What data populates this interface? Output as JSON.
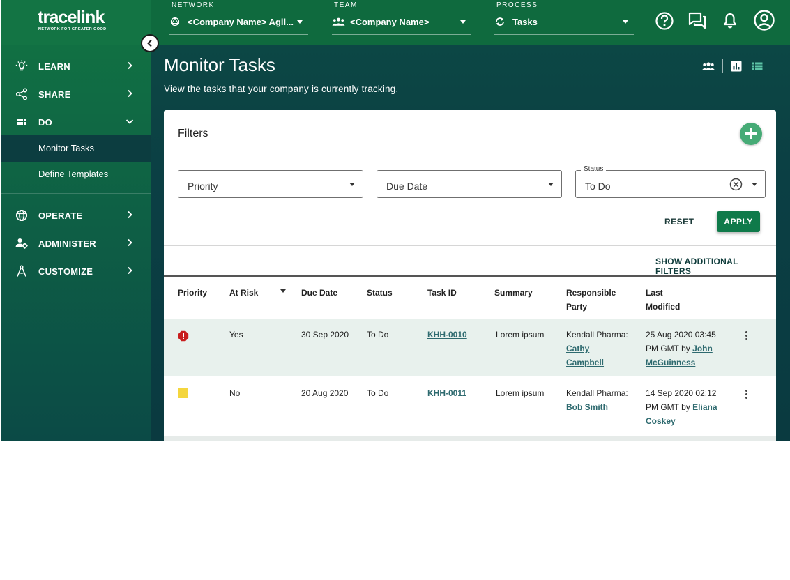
{
  "brand": {
    "name": "tracelink",
    "tagline": "NETWORK FOR GREATER GOOD"
  },
  "header": {
    "network": {
      "label": "NETWORK",
      "value": "<Company Name> Agil..."
    },
    "team": {
      "label": "TEAM",
      "value": "<Company Name>"
    },
    "process": {
      "label": "PROCESS",
      "value": "Tasks"
    },
    "icons": [
      "help-icon",
      "chat-icon",
      "notification-bell-icon",
      "account-icon"
    ]
  },
  "sidebar": {
    "items": [
      {
        "label": "LEARN",
        "icon": "lightbulb-icon"
      },
      {
        "label": "SHARE",
        "icon": "share-icon"
      },
      {
        "label": "DO",
        "icon": "grid-icon",
        "expanded": true,
        "children": [
          {
            "label": "Monitor Tasks",
            "active": true
          },
          {
            "label": "Define Templates",
            "active": false
          }
        ]
      },
      {
        "label": "OPERATE",
        "icon": "globe-icon"
      },
      {
        "label": "ADMINISTER",
        "icon": "user-gear-icon"
      },
      {
        "label": "CUSTOMIZE",
        "icon": "compass-icon"
      }
    ]
  },
  "page": {
    "title": "Monitor Tasks",
    "subtitle": "View the tasks that your company is currently tracking.",
    "views": [
      "people-view-icon",
      "chart-view-icon",
      "list-view-icon"
    ]
  },
  "filters": {
    "title": "Filters",
    "priority": {
      "placeholder": "Priority"
    },
    "due_date": {
      "placeholder": "Due Date"
    },
    "status": {
      "label": "Status",
      "value": "To Do"
    },
    "reset": "RESET",
    "apply": "APPLY",
    "show_more": "SHOW ADDITIONAL FILTERS"
  },
  "table": {
    "columns": [
      "Priority",
      "At Risk",
      "Due Date",
      "Status",
      "Task ID",
      "Summary",
      "Responsible",
      "Party",
      "Last",
      "Modified"
    ],
    "rows": [
      {
        "priority": "high",
        "at_risk": "Yes",
        "due_date": "30 Sep 2020",
        "status": "To Do",
        "task_id": "KHH-0010",
        "summary": "Lorem ipsum",
        "party_org": "Kendall Pharma:",
        "party_first": "Cathy",
        "party_last": "Campbell",
        "modified_line1": "25 Aug 2020 03:45",
        "modified_line2": "PM GMT by",
        "modified_user1": "John",
        "modified_user2": "McGuinness"
      },
      {
        "priority": "medium",
        "at_risk": "No",
        "due_date": "20 Aug 2020",
        "status": "To Do",
        "task_id": "KHH-0011",
        "summary": "Lorem ipsum",
        "party_org": "Kendall Pharma:",
        "party_first": "Bob Smith",
        "modified_line1": "14 Sep 2020 02:12",
        "modified_line2": "PM GMT by",
        "modified_user1": "Eliana",
        "modified_user2": "Coskey"
      }
    ]
  },
  "colors": {
    "header_green": "#0f6a3e",
    "brand_green": "#137444",
    "accent_teal": "#0b3f44",
    "apply_green": "#0f7a4a",
    "priority_high": "#c81e1e",
    "priority_medium": "#f4d63e"
  }
}
